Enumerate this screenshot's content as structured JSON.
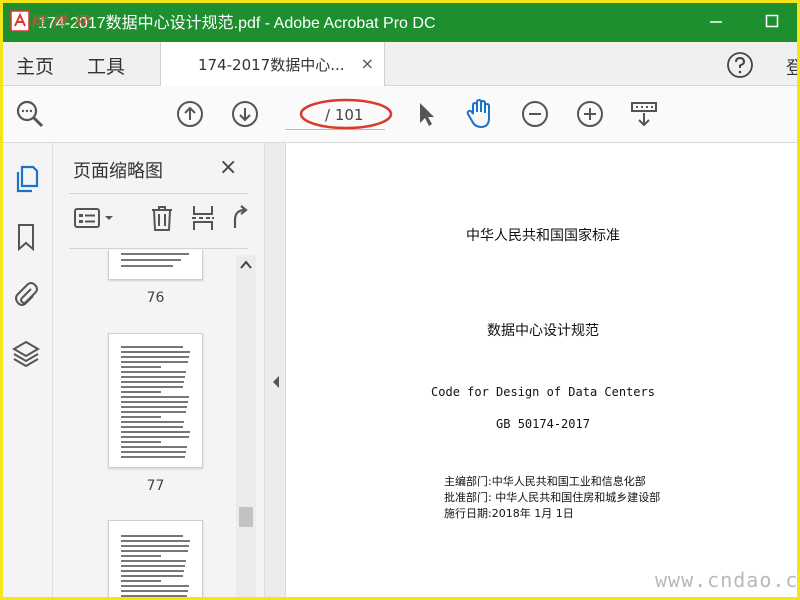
{
  "window": {
    "title": "174-2017数据中心设计规范.pdf - Adobe Acrobat Pro DC",
    "logo_text": "精 樟 网",
    "colors": {
      "titlebar": "#1e8f2e",
      "accent": "#1a73c7",
      "annotation_red": "#d93a2e",
      "frame": "#f2e51a"
    }
  },
  "nav": {
    "home": "主页",
    "tools": "工具"
  },
  "tab": {
    "label": "174-2017数据中心...",
    "close": "×"
  },
  "header_right": {
    "help_icon": "question-circle-icon",
    "cut_text": "登"
  },
  "toolbar": {
    "page_total": "/ 101",
    "icons": [
      "search-zoom-icon",
      "page-up-icon",
      "page-down-icon",
      "select-arrow-icon",
      "hand-tool-icon",
      "zoom-out-icon",
      "zoom-in-icon",
      "scroll-mode-icon"
    ]
  },
  "rail": {
    "icons": [
      "page-thumbnails-icon",
      "bookmark-icon",
      "attachment-icon",
      "layers-icon"
    ]
  },
  "panel": {
    "title": "页面缩略图",
    "close": "×",
    "thumb_labels": [
      "76",
      "77"
    ]
  },
  "document": {
    "national_standard": "中华人民共和国国家标准",
    "title_cn": "数据中心设计规范",
    "title_en": "Code for Design of Data Centers",
    "code": "GB 50174-2017",
    "meta": [
      "主编部门:中华人民共和国工业和信息化部",
      "批准部门: 中华人民共和国住房和城乡建设部",
      "施行日期:2018年 1月 1日"
    ]
  },
  "watermark": "www.cndao.com"
}
